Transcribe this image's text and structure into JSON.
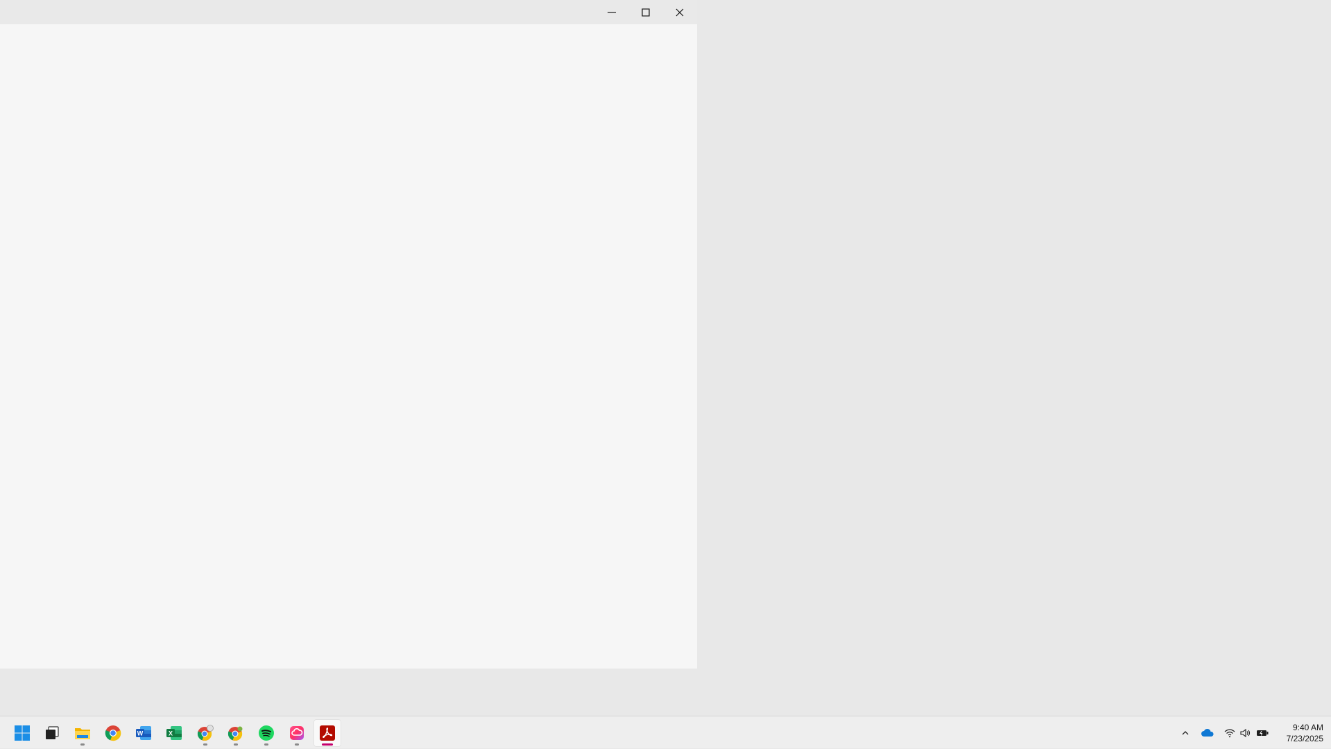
{
  "window": {
    "minimize_label": "",
    "maximize_label": "",
    "close_label": ""
  },
  "taskbar": {
    "apps": [
      {
        "name": "start",
        "icon": "windows-logo-icon",
        "running": false
      },
      {
        "name": "task-view",
        "icon": "task-view-icon",
        "running": false
      },
      {
        "name": "file-explorer",
        "icon": "folder-icon",
        "running": true
      },
      {
        "name": "chrome",
        "icon": "chrome-icon",
        "running": false
      },
      {
        "name": "word",
        "icon": "word-icon",
        "running": false
      },
      {
        "name": "excel",
        "icon": "excel-icon",
        "running": false
      },
      {
        "name": "chrome-profile",
        "icon": "chrome-icon",
        "running": true
      },
      {
        "name": "chrome-profile-2",
        "icon": "chrome-icon",
        "running": true
      },
      {
        "name": "spotify",
        "icon": "spotify-icon",
        "running": true
      },
      {
        "name": "creative-cloud",
        "icon": "creative-cloud-icon",
        "running": true
      },
      {
        "name": "acrobat",
        "icon": "acrobat-icon",
        "running": true,
        "active": true
      }
    ],
    "tray": {
      "icons": [
        "chevron-up-icon",
        "onedrive-icon",
        "wifi-icon",
        "volume-icon",
        "battery-icon"
      ]
    },
    "clock": {
      "time": "9:40 AM",
      "date": "7/23/2025"
    }
  },
  "colors": {
    "desktop": "#e8e8e8",
    "window": "#f6f6f6",
    "titlebar": "#e9e9e9",
    "accent": "#c5006d"
  }
}
